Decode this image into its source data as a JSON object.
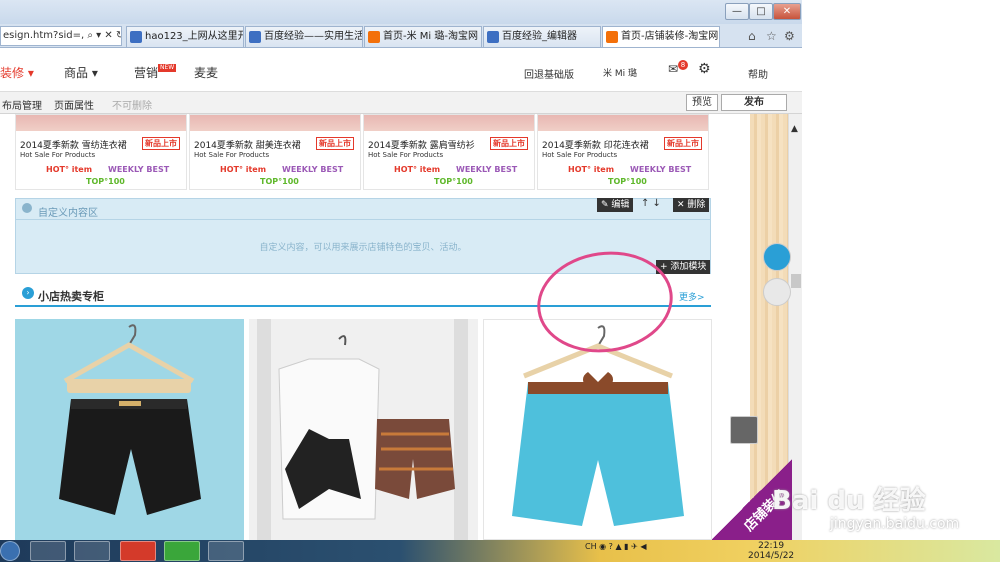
{
  "browser": {
    "address": "esign.htm?sid=,",
    "tabs": [
      {
        "label": "hao123_上网从这里开始",
        "fav": "blue"
      },
      {
        "label": "百度经验——实用生活...",
        "fav": "blue"
      },
      {
        "label": "首页-米 Mi 璐-淘宝网",
        "fav": "orange"
      },
      {
        "label": "百度经验_编辑器",
        "fav": "blue"
      },
      {
        "label": "首页-店铺装修-淘宝网",
        "fav": "orange"
      }
    ],
    "window_controls": [
      "—",
      "□",
      "✕"
    ],
    "tab_icons": [
      "⌂",
      "☆",
      "⚙"
    ]
  },
  "site_nav": {
    "decorate": "装修 ▾",
    "goods": "商品 ▾",
    "marketing": "营销",
    "new_badge": "NEW",
    "maimai": "麦麦",
    "back_basic": "回退基础版",
    "shop_name": "米 Mi 璐",
    "mail_count": "8",
    "help": "帮助"
  },
  "toolbar": {
    "layout": "布局管理",
    "page_props": "页面属性",
    "cannot_delete": "不可删除",
    "preview": "预览",
    "publish": "发布"
  },
  "products_top": [
    {
      "name": "2014夏季新款 雪纺连衣裙",
      "sub": "Hot Sale For Products",
      "tag": "新品上市",
      "hot": "HOT° item",
      "weekly": "WEEKLY BEST",
      "top": "TOP°100"
    },
    {
      "name": "2014夏季新款 甜美连衣裙",
      "sub": "Hot Sale For Products",
      "tag": "新品上市",
      "hot": "HOT° item",
      "weekly": "WEEKLY BEST",
      "top": "TOP°100"
    },
    {
      "name": "2014夏季新款 露肩雪纺衫",
      "sub": "Hot Sale For Products",
      "tag": "新品上市",
      "hot": "HOT° item",
      "weekly": "WEEKLY BEST",
      "top": "TOP°100"
    },
    {
      "name": "2014夏季新款 印花连衣裙",
      "sub": "Hot Sale For Products",
      "tag": "新品上市",
      "hot": "HOT° item",
      "weekly": "WEEKLY BEST",
      "top": "TOP°100"
    }
  ],
  "custom_module": {
    "title": "自定义内容区",
    "hint": "自定义内容，可以用来展示店铺特色的宝贝、活动。",
    "edit": "✎ 编辑",
    "delete": "✕ 删除",
    "add_module": "+ 添加模块",
    "arrows": "↑ ↓"
  },
  "hot_section": {
    "title": "小店热卖专柜",
    "more": "更多>"
  },
  "taskbar": {
    "lang": "CH",
    "time": "22:19",
    "date": "2014/5/22"
  },
  "watermark": {
    "brand": "Bai du 经验",
    "url": "jingyan.baidu.com",
    "ribbon": "店铺装修"
  },
  "colors": {
    "accent": "#e4392b",
    "blue": "#2a9fd6",
    "highlight_circle": "#e0488a"
  }
}
